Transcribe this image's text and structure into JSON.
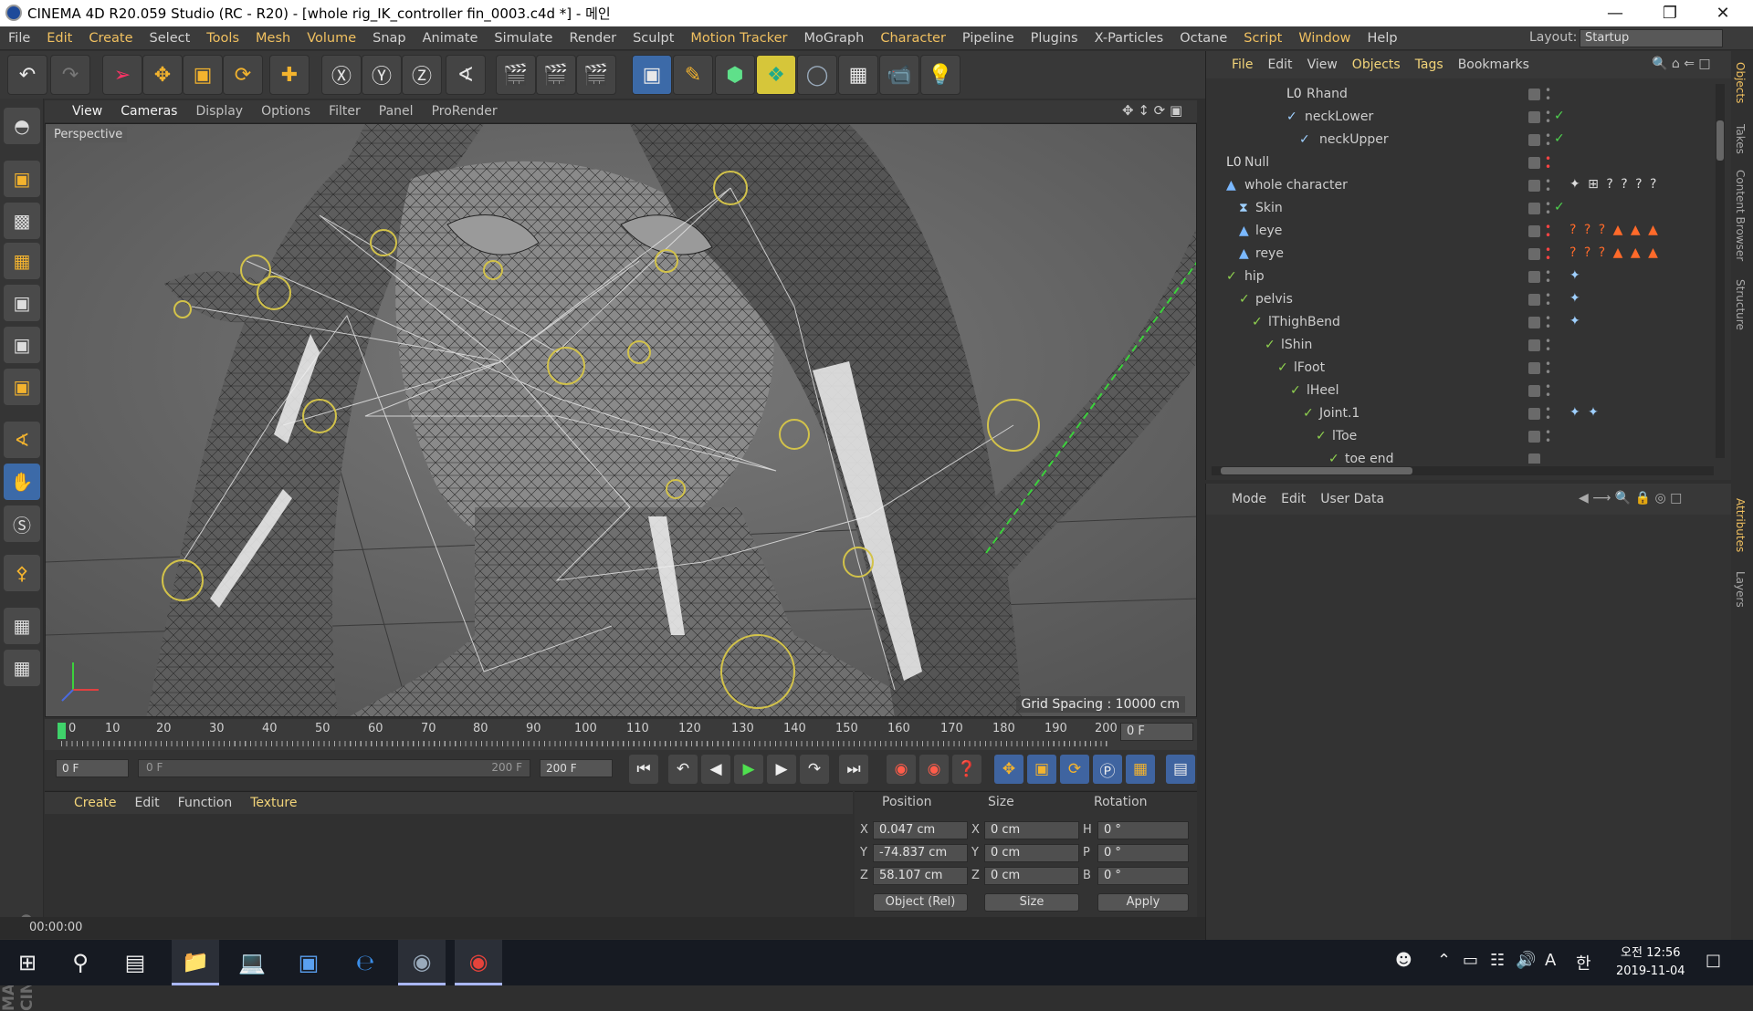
{
  "window": {
    "title": "CINEMA 4D R20.059 Studio (RC - R20) - [whole rig_IK_controller fin_0003.c4d *] - 메인",
    "controls": [
      "minimize-icon",
      "restore-icon",
      "close-icon"
    ]
  },
  "menubar": {
    "items": [
      "File",
      "Edit",
      "Create",
      "Select",
      "Tools",
      "Mesh",
      "Volume",
      "Snap",
      "Animate",
      "Simulate",
      "Render",
      "Sculpt",
      "Motion Tracker",
      "MoGraph",
      "Character",
      "Pipeline",
      "Plugins",
      "X-Particles",
      "Octane",
      "Script",
      "Window",
      "Help"
    ],
    "highlighted": [
      "File",
      "Edit",
      "Create",
      "Tools",
      "Mesh",
      "Volume",
      "Motion Tracker",
      "Character",
      "Script",
      "Window"
    ],
    "layout_label": "Layout:",
    "layout_value": "Startup"
  },
  "viewport": {
    "menu": [
      "View",
      "Cameras",
      "Display",
      "Options",
      "Filter",
      "Panel",
      "ProRender"
    ],
    "camera_label": "Perspective",
    "grid_spacing": "Grid Spacing : 10000 cm"
  },
  "timeline": {
    "ticks": [
      "0",
      "10",
      "20",
      "30",
      "40",
      "50",
      "60",
      "70",
      "80",
      "90",
      "100",
      "110",
      "120",
      "130",
      "140",
      "150",
      "160",
      "170",
      "180",
      "190",
      "200"
    ],
    "current_frame": "0 F"
  },
  "transport": {
    "start_field": "0 F",
    "range_start": "0 F",
    "range_end": "200 F",
    "end_field": "200 F"
  },
  "material_panel": {
    "menu": [
      "Create",
      "Edit",
      "Function",
      "Texture"
    ]
  },
  "coordinates": {
    "headers": [
      "Position",
      "Size",
      "Rotation"
    ],
    "rows": [
      {
        "axis": "X",
        "pos": "0.047 cm",
        "size_axis": "X",
        "size": "0 cm",
        "rot_axis": "H",
        "rot": "0 °"
      },
      {
        "axis": "Y",
        "pos": "-74.837 cm",
        "size_axis": "Y",
        "size": "0 cm",
        "rot_axis": "P",
        "rot": "0 °"
      },
      {
        "axis": "Z",
        "pos": "58.107 cm",
        "size_axis": "Z",
        "size": "0 cm",
        "rot_axis": "B",
        "rot": "0 °"
      }
    ],
    "mode_select": "Object (Rel)",
    "size_select": "Size",
    "apply_label": "Apply"
  },
  "status": {
    "time": "00:00:00"
  },
  "object_manager": {
    "menu": [
      "File",
      "Edit",
      "View",
      "Objects",
      "Tags",
      "Bookmarks"
    ],
    "rows": [
      {
        "name": "Rhand",
        "dot": "gray",
        "check": false,
        "tags": ""
      },
      {
        "name": "neckLower",
        "dot": "gray",
        "check": true,
        "tags": ""
      },
      {
        "name": "neckUpper",
        "dot": "gray",
        "check": true,
        "tags": ""
      },
      {
        "name": "Null",
        "dot": "red",
        "check": false,
        "tags": ""
      },
      {
        "name": "whole character",
        "dot": "gray",
        "check": false,
        "tags": "✦ ⊞ ? ? ? ?"
      },
      {
        "name": "Skin",
        "dot": "gray",
        "check": true,
        "tags": ""
      },
      {
        "name": "leye",
        "dot": "red",
        "check": false,
        "tags": "? ? ? ▲ ▲ ▲"
      },
      {
        "name": "reye",
        "dot": "red",
        "check": false,
        "tags": "? ? ? ▲ ▲ ▲"
      },
      {
        "name": "hip",
        "dot": "gray",
        "check": false,
        "tags": "✦"
      },
      {
        "name": "pelvis",
        "dot": "gray",
        "check": false,
        "tags": "✦"
      },
      {
        "name": "lThighBend",
        "dot": "gray",
        "check": false,
        "tags": "✦"
      },
      {
        "name": "lShin",
        "dot": "gray",
        "check": false,
        "tags": ""
      },
      {
        "name": "lFoot",
        "dot": "gray",
        "check": false,
        "tags": ""
      },
      {
        "name": "lHeel",
        "dot": "gray",
        "check": false,
        "tags": ""
      },
      {
        "name": "Joint.1",
        "dot": "gray",
        "check": false,
        "tags": "✦ ✦"
      },
      {
        "name": "lToe",
        "dot": "gray",
        "check": false,
        "tags": ""
      },
      {
        "name": "toe end",
        "dot": "gray",
        "check": false,
        "tags": ""
      }
    ]
  },
  "attributes": {
    "menu": [
      "Mode",
      "Edit",
      "User Data"
    ]
  },
  "right_tabs": [
    "Objects",
    "Takes",
    "Content Browser",
    "Structure",
    "Attributes",
    "Layers"
  ],
  "taskbar": {
    "clock_time": "오전 12:56",
    "clock_date": "2019-11-04",
    "ime_label": "A",
    "lang_label": "한"
  },
  "colors": {
    "accent": "#f0c060",
    "timeline_cursor": "#3fd26a",
    "tag_orange": "#ff6a2a"
  }
}
